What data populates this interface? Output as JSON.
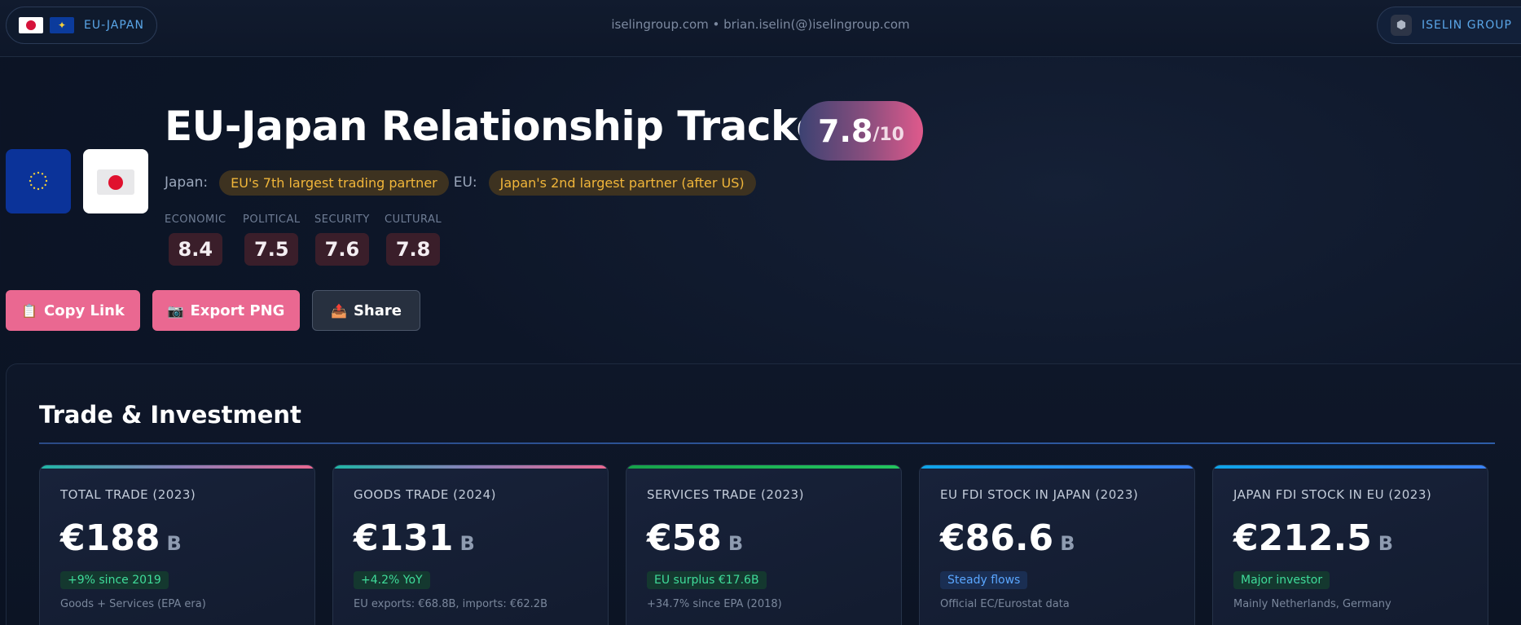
{
  "topbar": {
    "left_label": "EU-JAPAN",
    "contact": "iselingroup.com • brian.iselin(@)iselingroup.com",
    "right_label": "ISELIN GROUP"
  },
  "hero": {
    "title": "EU-Japan Relationship Tracker",
    "score": "7.8",
    "score_suffix": "/10",
    "relations": [
      {
        "key": "Japan:",
        "badge": "EU's 7th largest trading partner"
      },
      {
        "key": "EU:",
        "badge": "Japan's 2nd largest partner (after US)"
      }
    ],
    "dimensions": [
      {
        "label": "ECONOMIC",
        "value": "8.4"
      },
      {
        "label": "POLITICAL",
        "value": "7.5"
      },
      {
        "label": "SECURITY",
        "value": "7.6"
      },
      {
        "label": "CULTURAL",
        "value": "7.8"
      }
    ]
  },
  "actions": {
    "copy_link": "Copy Link",
    "export_png": "Export PNG",
    "share": "Share"
  },
  "icons": {
    "copy": "📋",
    "camera": "📷",
    "share": "📤",
    "logo": "⬢",
    "eu_star": "✦"
  },
  "trade": {
    "title": "Trade & Investment",
    "cards": [
      {
        "title": "TOTAL TRADE (2023)",
        "value": "€188",
        "unit": "B",
        "tag": "+9% since 2019",
        "tag_color": "green",
        "note": "Goods + Services (EPA era)",
        "bar": "#e0607a"
      },
      {
        "title": "GOODS TRADE (2024)",
        "value": "€131",
        "unit": "B",
        "tag": "+4.2% YoY",
        "tag_color": "green",
        "note": "EU exports: €68.8B, imports: €62.2B",
        "bar": "#e0607a"
      },
      {
        "title": "SERVICES TRADE (2023)",
        "value": "€58",
        "unit": "B",
        "tag": "EU surplus €17.6B",
        "tag_color": "green",
        "note": "+34.7% since EPA (2018)",
        "bar": "#22c55e"
      },
      {
        "title": "EU FDI STOCK IN JAPAN (2023)",
        "value": "€86.6",
        "unit": "B",
        "tag": "Steady flows",
        "tag_color": "blue",
        "note": "Official EC/Eurostat data",
        "bar": "#3b82f6"
      },
      {
        "title": "JAPAN FDI STOCK IN EU (2023)",
        "value": "€212.5",
        "unit": "B",
        "tag": "Major investor",
        "tag_color": "green",
        "note": "Mainly Netherlands, Germany",
        "bar": "#3b82f6"
      }
    ]
  }
}
